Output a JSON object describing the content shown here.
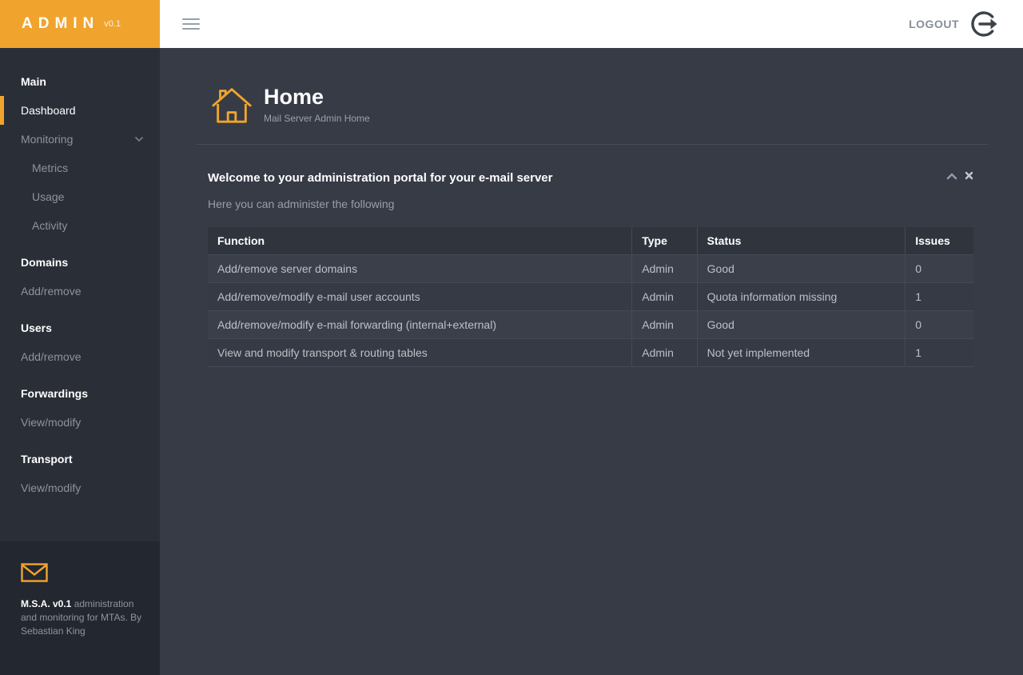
{
  "colors": {
    "accent_orange": "#F0A42D",
    "sidebar_bg": "#2A2E37",
    "sidebar_footer_bg": "#23272F",
    "main_bg": "#363B46",
    "topbar_bg": "#FFFFFF"
  },
  "topbar": {
    "logo_text": "ADMIN",
    "version": "v0.1",
    "logout_label": "LOGOUT"
  },
  "sidebar": {
    "items": [
      {
        "label": "Main",
        "type": "header"
      },
      {
        "label": "Dashboard",
        "type": "link",
        "active": true
      },
      {
        "label": "Monitoring",
        "type": "link",
        "has_chevron": true
      },
      {
        "label": "Metrics",
        "type": "sublink"
      },
      {
        "label": "Usage",
        "type": "sublink"
      },
      {
        "label": "Activity",
        "type": "sublink"
      },
      {
        "label": "Domains",
        "type": "header"
      },
      {
        "label": "Add/remove",
        "type": "link"
      },
      {
        "label": "Users",
        "type": "header"
      },
      {
        "label": "Add/remove",
        "type": "link"
      },
      {
        "label": "Forwardings",
        "type": "header"
      },
      {
        "label": "View/modify",
        "type": "link"
      },
      {
        "label": "Transport",
        "type": "header"
      },
      {
        "label": "View/modify",
        "type": "link"
      }
    ],
    "footer": {
      "title": "M.S.A. v0.1",
      "text": " administration and monitoring for MTAs. By Sebastian King"
    }
  },
  "page": {
    "title": "Home",
    "subtitle": "Mail Server Admin Home"
  },
  "panel": {
    "title": "Welcome to your administration portal for your e-mail server",
    "subtitle": "Here you can administer the following"
  },
  "table": {
    "columns": [
      "Function",
      "Type",
      "Status",
      "Issues"
    ],
    "rows": [
      {
        "function": "Add/remove server domains",
        "type": "Admin",
        "status": "Good",
        "issues": "0"
      },
      {
        "function": "Add/remove/modify e-mail user accounts",
        "type": "Admin",
        "status": "Quota information missing",
        "issues": "1"
      },
      {
        "function": "Add/remove/modify e-mail forwarding (internal+external)",
        "type": "Admin",
        "status": "Good",
        "issues": "0"
      },
      {
        "function": "View and modify transport & routing tables",
        "type": "Admin",
        "status": "Not yet implemented",
        "issues": "1"
      }
    ]
  }
}
